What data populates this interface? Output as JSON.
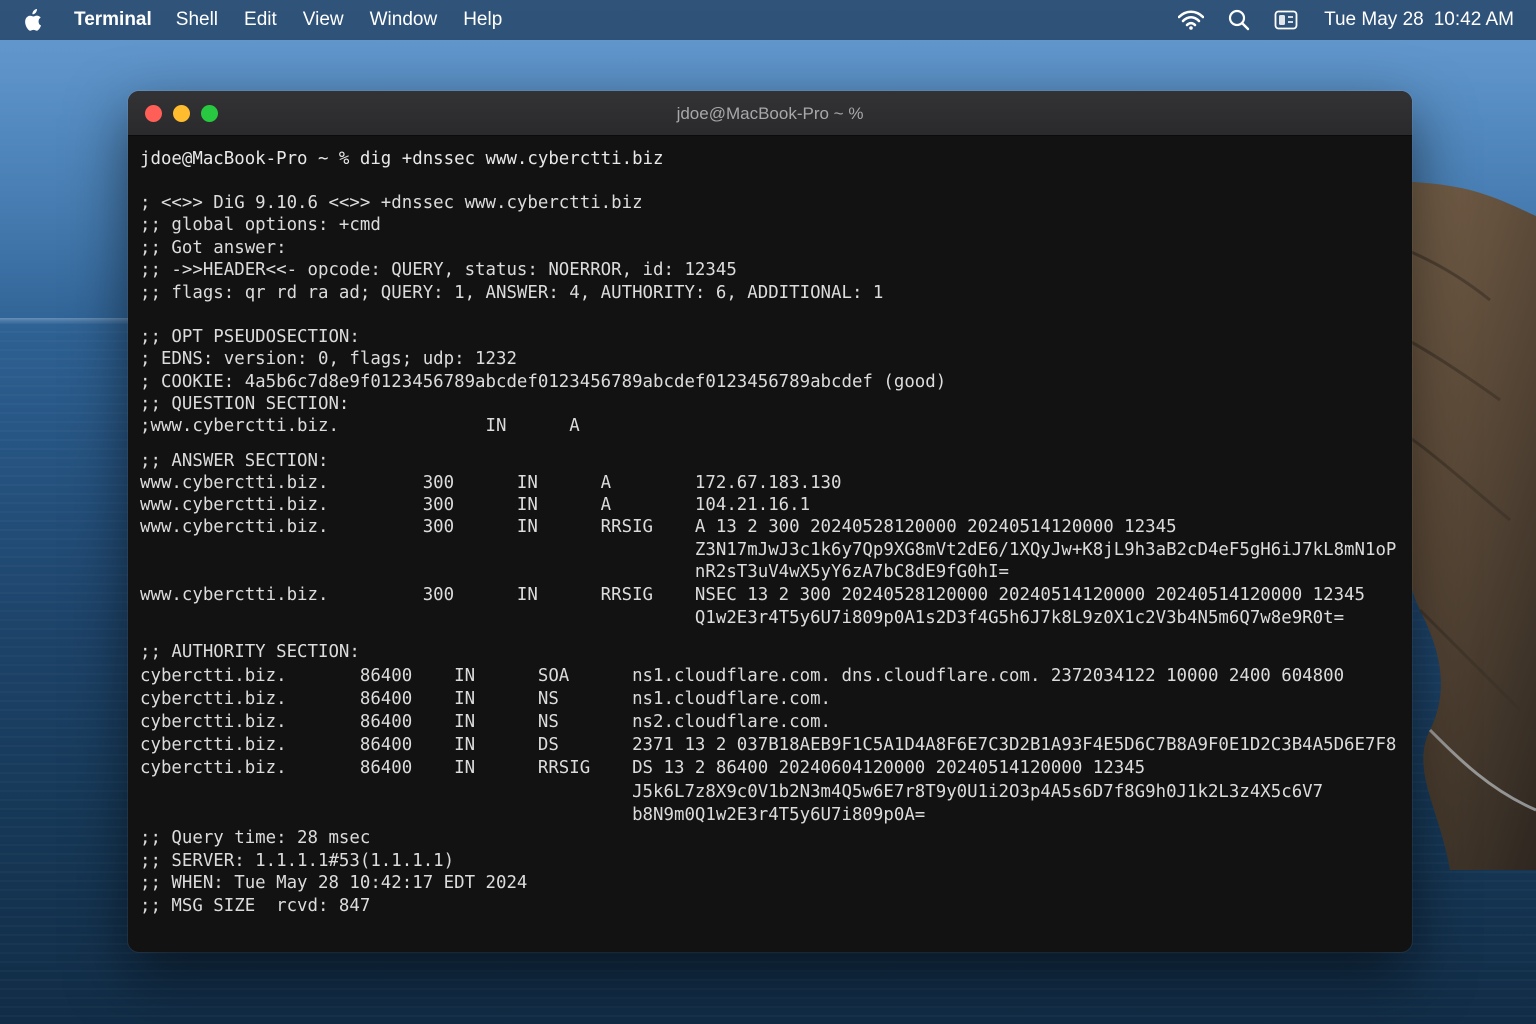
{
  "menubar": {
    "app_name": "Terminal",
    "menus": [
      "Shell",
      "Edit",
      "View",
      "Window",
      "Help"
    ],
    "clock_date": "Tue May 28",
    "clock_time": "10:42 AM",
    "icons": [
      "apple-icon",
      "wifi-icon",
      "search-icon",
      "control-center-icon"
    ]
  },
  "window": {
    "title": "jdoe@MacBook-Pro ~ %",
    "traffic_lights": {
      "close": "#ff5f57",
      "minimize": "#febc2e",
      "maximize": "#28c840"
    }
  },
  "terminal": {
    "lines": [
      "jdoe@MacBook-Pro ~ % dig +dnssec www.cyberctti.biz",
      "; <<>> DiG 9.10.6 <<>> +dnssec www.cyberctti.biz",
      ";; global options: +cmd",
      ";; Got answer:",
      ";; ->>HEADER<<- opcode: QUERY, status: NOERROR, id: 12345",
      ";; flags: qr rd ra ad; QUERY: 1, ANSWER: 4, AUTHORITY: 6, ADDITIONAL: 1",
      ";; OPT PSEUDOSECTION:",
      "; EDNS: version: 0, flags; udp: 1232",
      "; COOKIE: 4a5b6c7d8e9f0123456789abcdef0123456789abcdef0123456789abcdef (good)",
      ";; QUESTION SECTION:",
      ";www.cyberctti.biz.              IN      A",
      ";; ANSWER SECTION:",
      "www.cyberctti.biz.         300      IN      A        172.67.183.130",
      "www.cyberctti.biz.         300      IN      A        104.21.16.1",
      "www.cyberctti.biz.         300      IN      RRSIG    A 13 2 300 20240528120000 20240514120000 12345",
      "                                                     Z3N17mJwJ3c1k6y7Qp9XG8mVt2dE6/1XQyJw+K8jL9h3aB2cD4eF5gH6iJ7kL8mN1oP",
      "                                                     nR2sT3uV4wX5yY6zA7bC8dE9fG0hI=",
      "www.cyberctti.biz.         300      IN      RRSIG    NSEC 13 2 300 20240528120000 20240514120000 20240514120000 12345",
      "                                                     Q1w2E3r4T5y6U7i809p0A1s2D3f4G5h6J7k8L9z0X1c2V3b4N5m6Q7w8e9R0t=",
      ";; AUTHORITY SECTION:",
      "cyberctti.biz.       86400    IN      SOA      ns1.cloudflare.com. dns.cloudflare.com. 2372034122 10000 2400 604800",
      "cyberctti.biz.       86400    IN      NS       ns1.cloudflare.com.",
      "cyberctti.biz.       86400    IN      NS       ns2.cloudflare.com.",
      "cyberctti.biz.       86400    IN      DS       2371 13 2 037B18AEB9F1C5A1D4A8F6E7C3D2B1A93F4E5D6C7B8A9F0E1D2C3B4A5D6E7F8",
      "cyberctti.biz.       86400    IN      RRSIG    DS 13 2 86400 20240604120000 20240514120000 12345",
      "                                               J5k6L7z8X9c0V1b2N3m4Q5w6E7r8T9y0U1i2O3p4A5s6D7f8G9h0J1k2L3z4X5c6V7",
      "                                               b8N9m0Q1w2E3r4T5y6U7i809p0A=",
      ";; Query time: 28 msec",
      ";; SERVER: 1.1.1.1#53(1.1.1.1)",
      ";; WHEN: Tue May 28 10:42:17 EDT 2024",
      ";; MSG SIZE  rcvd: 847"
    ]
  }
}
